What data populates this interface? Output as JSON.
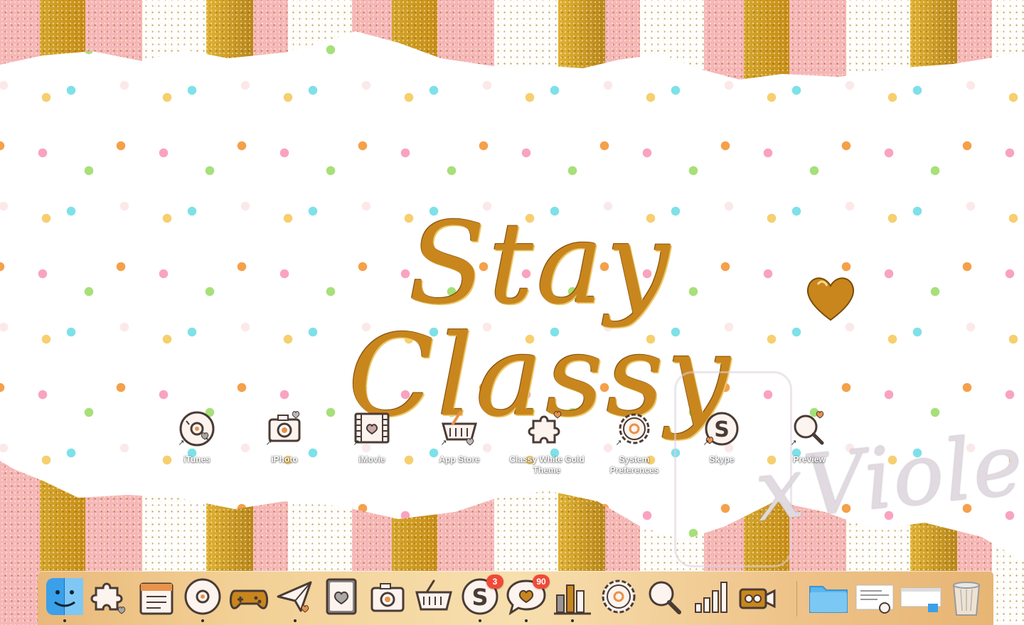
{
  "wallpaper": {
    "title": "Stay Classy",
    "watermark": "xViolet",
    "colors": {
      "pink": "#f6b6b9",
      "gold": "#c9861d",
      "dock": "#f2cf94"
    }
  },
  "desktop_icons": [
    {
      "label": "iTunes",
      "icon": "disc-hearts-icon"
    },
    {
      "label": "iPhoto",
      "icon": "camera-icon"
    },
    {
      "label": "iMovie",
      "icon": "film-heart-icon"
    },
    {
      "label": "App Store",
      "icon": "basket-icon"
    },
    {
      "label": "Classy White Gold Theme",
      "icon": "puzzle-icon"
    },
    {
      "label": "System Preferences",
      "icon": "gear-icon"
    },
    {
      "label": "Skype",
      "icon": "skype-icon"
    },
    {
      "label": "Preview",
      "icon": "magnifier-icon"
    }
  ],
  "dock": {
    "items": [
      {
        "name": "finder",
        "icon": "finder-icon",
        "running": true
      },
      {
        "name": "puzzle",
        "icon": "puzzle-icon",
        "running": false
      },
      {
        "name": "calendar",
        "icon": "calendar-icon",
        "running": false
      },
      {
        "name": "itunes",
        "icon": "disc-hearts-icon",
        "running": true
      },
      {
        "name": "games",
        "icon": "gamepad-icon",
        "running": false
      },
      {
        "name": "mail",
        "icon": "paper-plane-icon",
        "running": true
      },
      {
        "name": "contacts",
        "icon": "heart-book-icon",
        "running": false
      },
      {
        "name": "photos",
        "icon": "camera-icon",
        "running": false
      },
      {
        "name": "app-store",
        "icon": "basket-icon",
        "running": false
      },
      {
        "name": "skype",
        "icon": "skype-icon",
        "running": true,
        "badge": "3"
      },
      {
        "name": "messages",
        "icon": "speech-heart-icon",
        "running": true,
        "badge": "90"
      },
      {
        "name": "stats",
        "icon": "bars-icon",
        "running": true
      },
      {
        "name": "settings",
        "icon": "gear-icon",
        "running": false
      },
      {
        "name": "preview",
        "icon": "magnifier-icon",
        "running": false
      },
      {
        "name": "activity",
        "icon": "signal-bars-icon",
        "running": false
      },
      {
        "name": "video",
        "icon": "camcorder-icon",
        "running": false
      },
      {
        "name": "folder",
        "icon": "folder-icon",
        "running": false
      },
      {
        "name": "screenshot-1",
        "icon": "document-thumb-icon",
        "running": false
      },
      {
        "name": "screenshot-2",
        "icon": "window-thumb-icon",
        "running": false
      },
      {
        "name": "trash",
        "icon": "trash-icon",
        "running": false
      }
    ]
  }
}
